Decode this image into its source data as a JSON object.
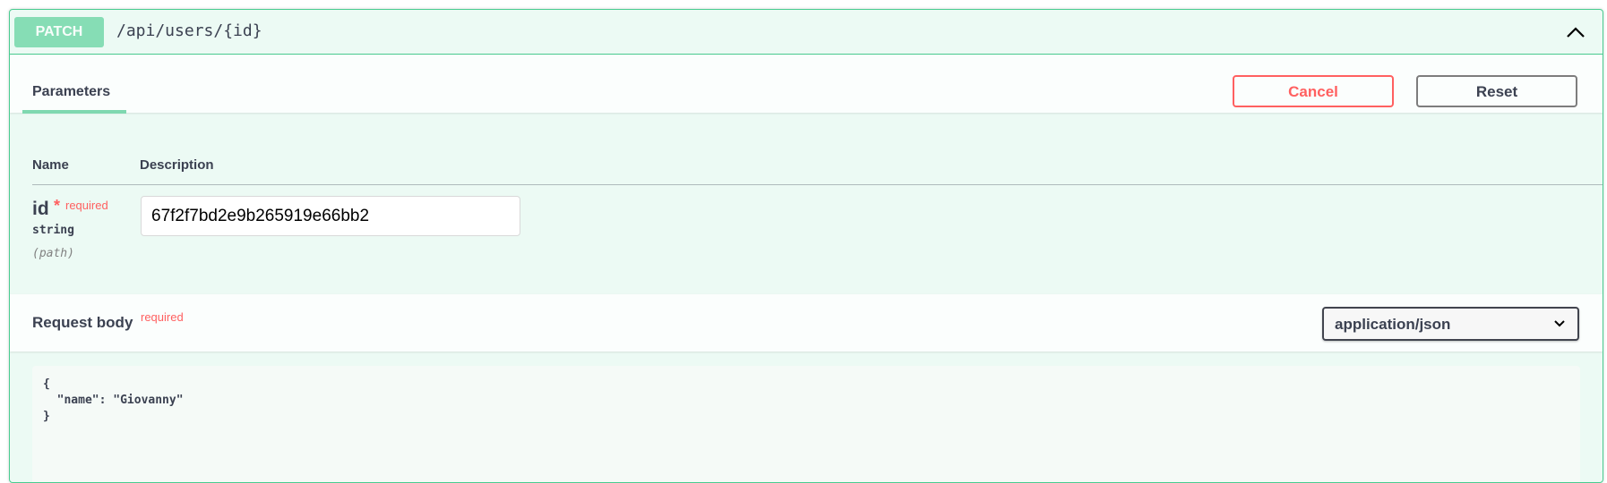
{
  "endpoint": {
    "method": "PATCH",
    "path": "/api/users/{id}"
  },
  "section": {
    "tab_label": "Parameters",
    "cancel_label": "Cancel",
    "reset_label": "Reset"
  },
  "params_table": {
    "name_header": "Name",
    "description_header": "Description"
  },
  "param_id": {
    "name": "id",
    "star": "*",
    "required": "required",
    "type": "string",
    "in": "(path)",
    "value": "67f2f7bd2e9b265919e66bb2"
  },
  "request_body": {
    "title": "Request body",
    "required": "required",
    "content_type": "application/json",
    "body": "{\n  \"name\": \"Giovanny\"\n}"
  },
  "icons": {
    "collapse": "chevron-up-icon",
    "select_arrow": "chevron-down-icon"
  },
  "colors": {
    "patch_accent": "#49cc90",
    "danger": "#ff6060",
    "text": "#3b4151"
  }
}
